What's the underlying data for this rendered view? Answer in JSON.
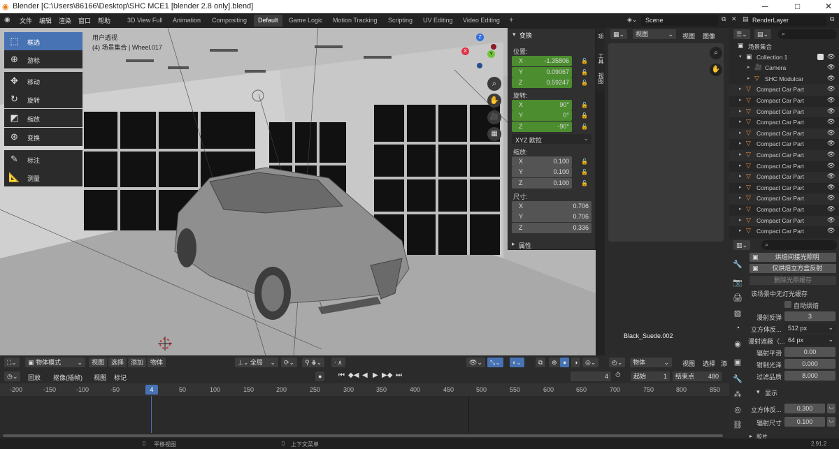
{
  "title_bar": {
    "title": "Blender [C:\\Users\\86166\\Desktop\\SHC MCE1 [blender 2.8 only].blend]",
    "minimize": "─",
    "maximize": "□",
    "close": "✕"
  },
  "menu": [
    "文件",
    "编辑",
    "渲染",
    "窗口",
    "帮助"
  ],
  "workspaces": [
    "3D View Full",
    "Animation",
    "Compositing",
    "Default",
    "Game Logic",
    "Motion Tracking",
    "Scripting",
    "UV Editing",
    "Video Editing",
    "+"
  ],
  "scene": {
    "name": "Scene",
    "render_layer": "RenderLayer"
  },
  "viewport": {
    "view_name": "用户透视",
    "object_info": "(4) 场景集合 | Wheel.017",
    "material_label": "Black_Suede.002",
    "tools": [
      {
        "label": "框选",
        "icon": "select-box-icon"
      },
      {
        "label": "游标",
        "icon": "cursor-icon"
      },
      {
        "label": "移动",
        "icon": "move-icon"
      },
      {
        "label": "旋转",
        "icon": "rotate-icon"
      },
      {
        "label": "缩放",
        "icon": "scale-icon"
      },
      {
        "label": "变换",
        "icon": "transform-icon"
      },
      {
        "label": "标注",
        "icon": "annotate-icon"
      },
      {
        "label": "测量",
        "icon": "measure-icon"
      }
    ],
    "gizmo": {
      "x": "X",
      "y": "Y",
      "z": "Z"
    }
  },
  "npanel": {
    "header": "变换",
    "location_label": "位置:",
    "location": [
      {
        "axis": "X",
        "value": "-1.35806"
      },
      {
        "axis": "Y",
        "value": "0.09067"
      },
      {
        "axis": "Z",
        "value": "0.59247"
      }
    ],
    "rotation_label": "旋转:",
    "rotation": [
      {
        "axis": "X",
        "value": "90°"
      },
      {
        "axis": "Y",
        "value": "0°"
      },
      {
        "axis": "Z",
        "value": "-90°"
      }
    ],
    "rotation_mode": "XYZ 欧拉",
    "scale_label": "缩放:",
    "scale": [
      {
        "axis": "X",
        "value": "0.100"
      },
      {
        "axis": "Y",
        "value": "0.100"
      },
      {
        "axis": "Z",
        "value": "0.100"
      }
    ],
    "dimensions_label": "尺寸:",
    "dimensions": [
      {
        "axis": "X",
        "value": "0.706"
      },
      {
        "axis": "Y",
        "value": "0.706"
      },
      {
        "axis": "Z",
        "value": "0.336"
      }
    ],
    "attributes": "属性",
    "side_tabs": [
      "项",
      "工具",
      "视图"
    ]
  },
  "viewport_header": {
    "mode": "物体模式",
    "menus": [
      "视图",
      "选择",
      "添加",
      "物体"
    ],
    "orientation": "全局"
  },
  "image_editor": {
    "menus": [
      "视图",
      "视图",
      "图像"
    ],
    "bottom_mode": "物体",
    "bottom_menus": [
      "视图",
      "选择",
      "添"
    ]
  },
  "timeline": {
    "menus": [
      "回放",
      "抠像(插帧)",
      "视图",
      "标记"
    ],
    "current_frame": "4",
    "start_label": "起始",
    "start": "1",
    "end_label": "结束点",
    "end": "480",
    "ticks": [
      "-200",
      "-150",
      "-100",
      "-50",
      "4",
      "50",
      "100",
      "150",
      "200",
      "250",
      "300",
      "350",
      "400",
      "450",
      "500",
      "550",
      "600",
      "650",
      "700",
      "750",
      "800",
      "850"
    ]
  },
  "outliner": {
    "rows": [
      {
        "name": "场景集合",
        "indent": 0,
        "type": "scene"
      },
      {
        "name": "Collection 1",
        "indent": 1,
        "type": "collection"
      },
      {
        "name": "Camera",
        "indent": 2,
        "type": "camera"
      },
      {
        "name": "SHC Modulcar",
        "indent": 2,
        "type": "object"
      },
      {
        "name": "Compact Car Part",
        "indent": 1,
        "type": "mesh"
      },
      {
        "name": "Compact Car Part",
        "indent": 1,
        "type": "mesh"
      },
      {
        "name": "Compact Car Part",
        "indent": 1,
        "type": "mesh"
      },
      {
        "name": "Compact Car Part",
        "indent": 1,
        "type": "mesh"
      },
      {
        "name": "Compact Car Part",
        "indent": 1,
        "type": "mesh"
      },
      {
        "name": "Compact Car Part",
        "indent": 1,
        "type": "mesh"
      },
      {
        "name": "Compact Car Part",
        "indent": 1,
        "type": "mesh"
      },
      {
        "name": "Compact Car Part",
        "indent": 1,
        "type": "mesh"
      },
      {
        "name": "Compact Car Part",
        "indent": 1,
        "type": "mesh"
      },
      {
        "name": "Compact Car Part",
        "indent": 1,
        "type": "mesh"
      },
      {
        "name": "Compact Car Part",
        "indent": 1,
        "type": "mesh"
      },
      {
        "name": "Compact Car Part",
        "indent": 1,
        "type": "mesh"
      },
      {
        "name": "Compact Car Part",
        "indent": 1,
        "type": "mesh"
      },
      {
        "name": "Compact Car Part",
        "indent": 1,
        "type": "mesh"
      }
    ]
  },
  "properties": {
    "bake_indirect": "烘焙间接光照明",
    "bake_cubemap": "仅烘焙立方盒反射",
    "delete_cache": "删除光照缓存",
    "no_cache": "该场景中无灯光缓存",
    "auto_bake": "自动烘焙",
    "diffuse_bounces_label": "漫射反弹",
    "diffuse_bounces": "3",
    "cubemap_size_label": "立方体反...",
    "cubemap_size": "512 px",
    "diffuse_filter_label": "漫射遮蔽（...",
    "diffuse_filter": "64 px",
    "irr_smoothing_label": "辐射平滑",
    "irr_smoothing": "0.00",
    "clamp_glossy_label": "钳制光泽",
    "clamp_glossy": "0.000",
    "filter_quality_label": "过滤品质",
    "filter_quality": "8.000",
    "display_label": "显示",
    "cubemap_display_label": "立方体反...",
    "cubemap_display": "0.300",
    "irr_size_label": "辐射尺寸",
    "irr_size": "0.100",
    "more_label": "胶片"
  },
  "status": {
    "left": "平移视图",
    "middle": "上下文菜单",
    "version": "2.91.2"
  }
}
